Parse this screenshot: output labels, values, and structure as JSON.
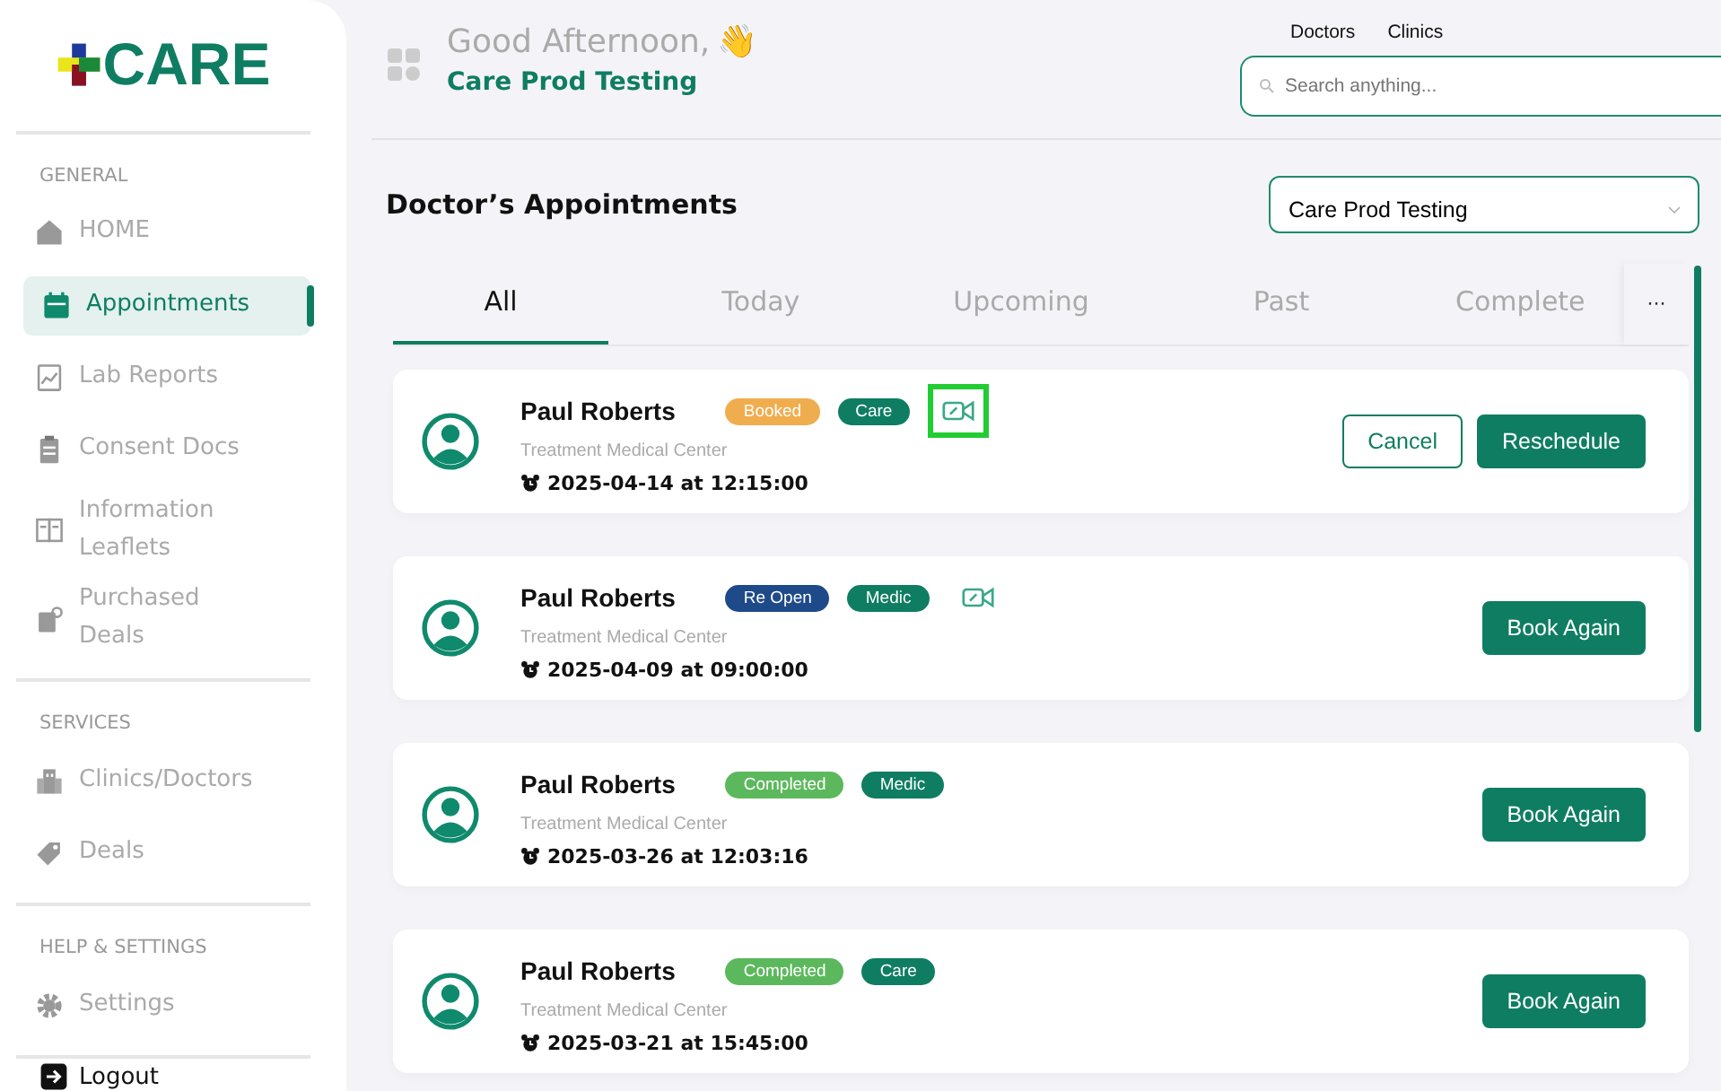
{
  "logo": {
    "text": "CARE"
  },
  "sidebar": {
    "sections": [
      {
        "title": "GENERAL",
        "items": [
          {
            "label": "HOME",
            "selected": false
          },
          {
            "label": "Appointments",
            "selected": true
          },
          {
            "label": "Lab Reports",
            "selected": false
          },
          {
            "label": "Consent Docs",
            "selected": false
          },
          {
            "label": "Information Leaflets",
            "selected": false
          },
          {
            "label": "Purchased Deals",
            "selected": false
          }
        ]
      },
      {
        "title": "SERVICES",
        "items": [
          {
            "label": "Clinics/Doctors",
            "selected": false
          },
          {
            "label": "Deals",
            "selected": false
          }
        ]
      },
      {
        "title": "HELP & SETTINGS",
        "items": [
          {
            "label": "Settings",
            "selected": false
          }
        ]
      }
    ],
    "logout": "Logout"
  },
  "header": {
    "greeting": "Good Afternoon,",
    "emoji": "👋",
    "user": "Care Prod Testing",
    "links": [
      "Doctors",
      "Clinics"
    ],
    "search": {
      "placeholder": "Search anything..."
    }
  },
  "page": {
    "title": "Doctor’s Appointments",
    "select_value": "Care Prod Testing",
    "tabs": [
      {
        "label": "All",
        "selected": true
      },
      {
        "label": "Today",
        "selected": false
      },
      {
        "label": "Upcoming",
        "selected": false
      },
      {
        "label": "Past",
        "selected": false
      },
      {
        "label": "Complete",
        "selected": false
      }
    ],
    "more": "···",
    "appointments": [
      {
        "name": "Paul Roberts",
        "status": "Booked",
        "color": "#f0ad4e",
        "type": "Care",
        "video": true,
        "highlighted": true,
        "center": "Treatment Medical Center",
        "datetime": "2025-04-14 at 12:15:00",
        "actions": [
          {
            "label": "Cancel",
            "kind": "outline"
          },
          {
            "label": "Reschedule",
            "kind": "filled"
          }
        ]
      },
      {
        "name": "Paul Roberts",
        "status": "Re Open",
        "color": "#1e4a8a",
        "type": "Medic",
        "video": true,
        "highlighted": false,
        "center": "Treatment Medical Center",
        "datetime": "2025-04-09 at 09:00:00",
        "actions": [
          {
            "label": "Book Again",
            "kind": "filled"
          }
        ]
      },
      {
        "name": "Paul Roberts",
        "status": "Completed",
        "color": "#5cb85c",
        "type": "Medic",
        "video": false,
        "center": "Treatment Medical Center",
        "datetime": "2025-03-26 at 12:03:16",
        "actions": [
          {
            "label": "Book Again",
            "kind": "filled"
          }
        ]
      },
      {
        "name": "Paul Roberts",
        "status": "Completed",
        "color": "#5cb85c",
        "type": "Care",
        "video": false,
        "center": "Treatment Medical Center",
        "datetime": "2025-03-21 at 15:45:00",
        "actions": [
          {
            "label": "Book Again",
            "kind": "filled"
          }
        ]
      }
    ]
  }
}
